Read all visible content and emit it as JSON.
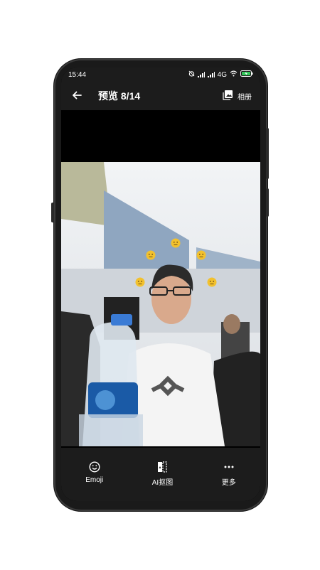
{
  "status": {
    "time": "15:44",
    "network": "4G",
    "battery_icon": "battery-charging-icon"
  },
  "topbar": {
    "back_icon": "arrow-left-icon",
    "title": "预览 8/14",
    "album_label": "相册",
    "album_icon": "gallery-icon"
  },
  "toolbar": {
    "items": [
      {
        "label": "Emoji",
        "icon": "smiley-icon"
      },
      {
        "label": "AI抠图",
        "icon": "cutout-icon"
      },
      {
        "label": "更多",
        "icon": "more-icon"
      }
    ]
  },
  "photo": {
    "emoji_icon": "neutral-face-icon",
    "emoji_color": "#f2c12e"
  }
}
